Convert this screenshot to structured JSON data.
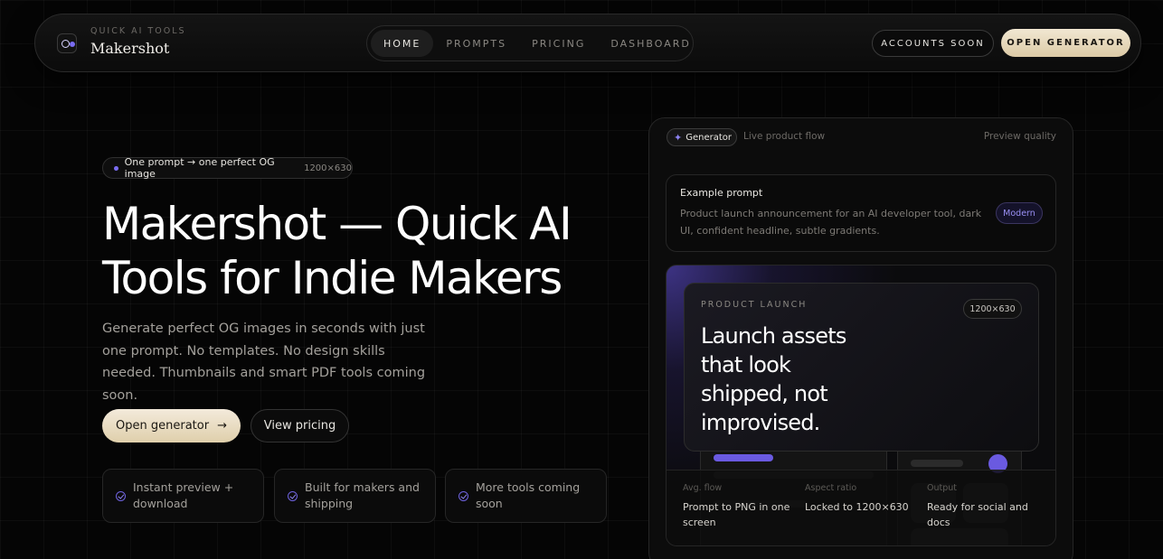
{
  "nav": {
    "brand_kicker": "QUICK AI TOOLS",
    "brand_name": "Makershot",
    "links": [
      {
        "label": "HOME",
        "active": true
      },
      {
        "label": "PROMPTS",
        "active": false
      },
      {
        "label": "PRICING",
        "active": false
      },
      {
        "label": "DASHBOARD",
        "active": false
      }
    ],
    "accounts_label": "ACCOUNTS SOON",
    "open_generator_label": "OPEN GENERATOR"
  },
  "hero": {
    "pill_text": "One prompt → one perfect OG image",
    "pill_size": "1200×630",
    "title": "Makershot — Quick AI Tools for Indie Makers",
    "subtitle": "Generate perfect OG images in seconds with just one prompt. No templates. No design skills needed. Thumbnails and smart PDF tools coming soon.",
    "primary_cta": "Open generator",
    "primary_cta_icon": "arrow-right-icon",
    "secondary_cta": "View pricing",
    "features": [
      "Instant preview + download",
      "Built for makers and shipping",
      "More tools coming soon"
    ]
  },
  "generator": {
    "badge": "Generator",
    "subtitle": "Live product flow",
    "quality": "Preview quality",
    "example_title": "Example prompt",
    "example_body": "Product launch announcement for an AI developer tool, dark UI, confident headline, subtle gradients.",
    "example_tag": "Modern",
    "preview": {
      "kicker": "PRODUCT LAUNCH",
      "size": "1200×630",
      "headline": "Launch assets that look shipped, not improvised."
    },
    "stats": [
      {
        "label": "Avg. flow",
        "value": "Prompt to PNG in one screen"
      },
      {
        "label": "Aspect ratio",
        "value": "Locked to 1200×630"
      },
      {
        "label": "Output",
        "value": "Ready for social and docs"
      }
    ]
  },
  "colors": {
    "accent": "#7a6cf0",
    "cta_gold": "#e8dcc0",
    "background": "#050505"
  }
}
